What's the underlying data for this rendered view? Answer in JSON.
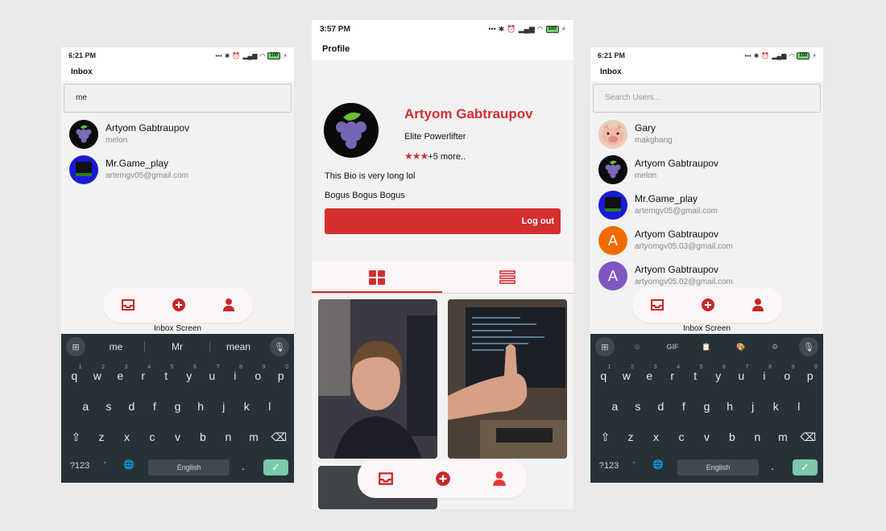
{
  "left_screen": {
    "status_time": "6:21 PM",
    "battery": "100",
    "title": "Inbox",
    "search_value": "me",
    "users": [
      {
        "name": "Artyom Gabtraupov",
        "sub": "melon"
      },
      {
        "name": "Mr.Game_play",
        "sub": "artemgv05@gmail.com"
      }
    ],
    "screen_label": "Inbox Screen",
    "suggestions": [
      "me",
      "Mr",
      "mean"
    ]
  },
  "middle_screen": {
    "status_time": "3:57 PM",
    "battery": "100",
    "title": "Profile",
    "name": "Artyom Gabtraupov",
    "role": "Elite Powerlifter",
    "stars": "★★★",
    "more": "+5 more..",
    "rating_value": 3,
    "bio": [
      "This Bio is very long lol",
      "Bogus Bogus Bogus"
    ],
    "logout_label": "Log out"
  },
  "right_screen": {
    "status_time": "6:21 PM",
    "battery": "100",
    "title": "Inbox",
    "search_placeholder": "Search Users...",
    "users": [
      {
        "name": "Gary",
        "sub": "makgbang"
      },
      {
        "name": "Artyom Gabtraupov",
        "sub": "melon"
      },
      {
        "name": "Mr.Game_play",
        "sub": "artemgv05@gmail.com"
      },
      {
        "name": "Artyom Gabtraupov",
        "sub": "artyomgv05.03@gmail.com",
        "initial": "A"
      },
      {
        "name": "Artyom Gabtraupov",
        "sub": "artyomgv05.02@gmail.com",
        "initial": "A"
      }
    ],
    "screen_label": "Inbox Screen",
    "toolbar_gif": "GIF"
  },
  "keyboard": {
    "row1": [
      "q",
      "w",
      "e",
      "r",
      "t",
      "y",
      "u",
      "i",
      "o",
      "p"
    ],
    "row1_hints": [
      "1",
      "2",
      "3",
      "4",
      "5",
      "6",
      "7",
      "8",
      "9",
      "0"
    ],
    "row2": [
      "a",
      "s",
      "d",
      "f",
      "g",
      "h",
      "j",
      "k",
      "l"
    ],
    "row3": [
      "z",
      "x",
      "c",
      "v",
      "b",
      "n",
      "m"
    ],
    "symbols": "?123",
    "space": "English",
    "comma": ",",
    "period": "."
  },
  "colors": {
    "accent": "#d32f2f",
    "keyboard_bg": "#263238",
    "enter": "#7cc7ae"
  }
}
